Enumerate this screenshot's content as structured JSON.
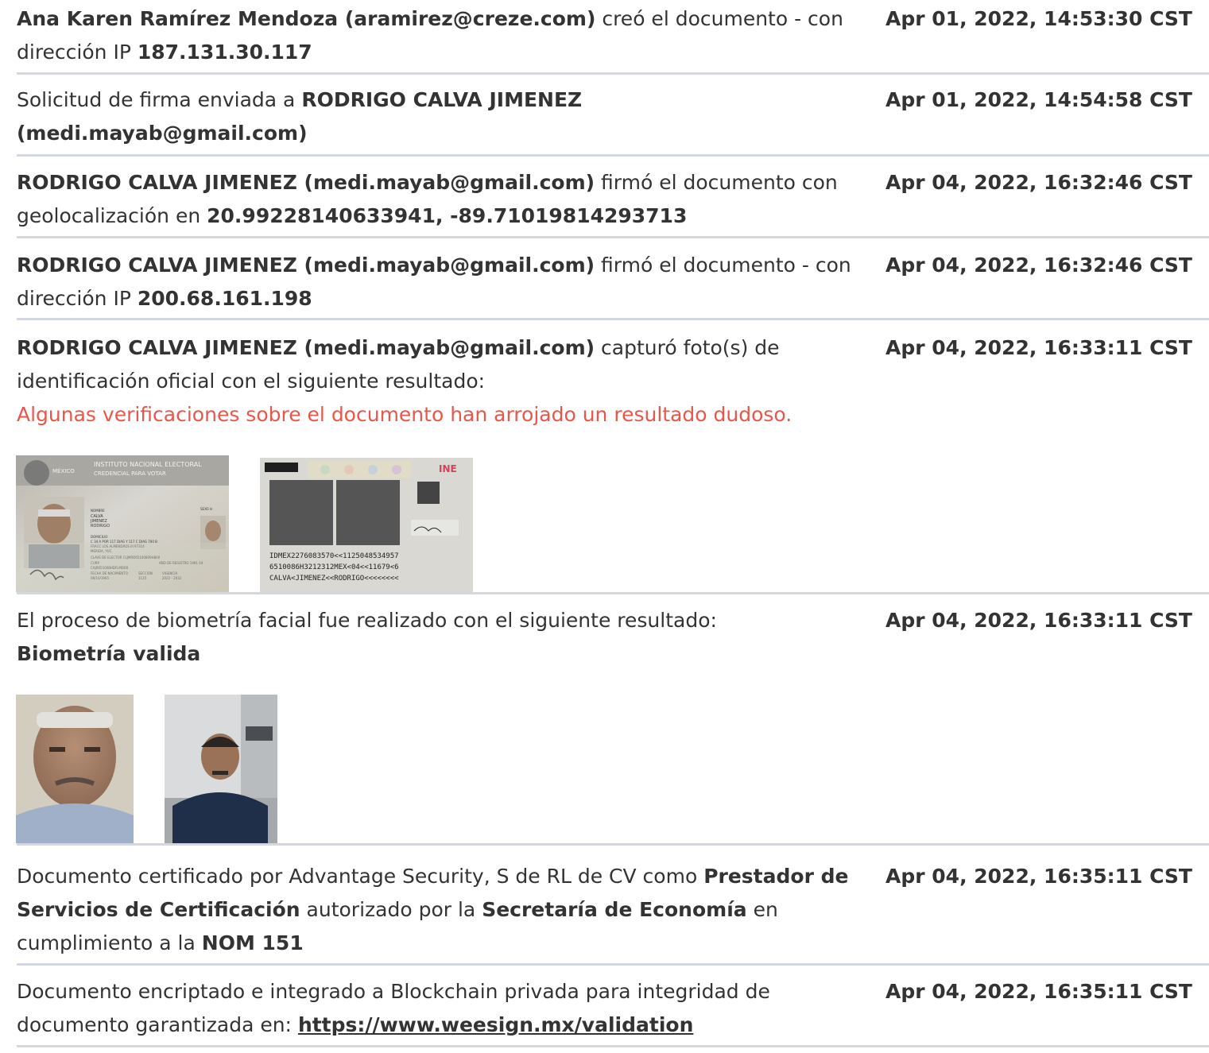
{
  "entries": [
    {
      "bold1": "Ana Karen Ramírez Mendoza (aramirez@creze.com)",
      "text1": " creó el documento - con dirección IP ",
      "bold2": "187.131.30.117",
      "timestamp": "Apr 01, 2022, 14:53:30 CST"
    },
    {
      "text1": "Solicitud de firma enviada a ",
      "bold1": "RODRIGO CALVA JIMENEZ (medi.mayab@gmail.com)",
      "timestamp": "Apr 01, 2022, 14:54:58 CST"
    },
    {
      "bold1": "RODRIGO CALVA JIMENEZ (medi.mayab@gmail.com)",
      "text1": " firmó el documento con geolocalización en ",
      "bold2": "20.99228140633941, -89.71019814293713",
      "timestamp": "Apr 04, 2022, 16:32:46 CST"
    },
    {
      "bold1": "RODRIGO CALVA JIMENEZ (medi.mayab@gmail.com)",
      "text1": " firmó el documento - con dirección IP ",
      "bold2": "200.68.161.198",
      "timestamp": "Apr 04, 2022, 16:32:46 CST"
    },
    {
      "bold1": "RODRIGO CALVA JIMENEZ (medi.mayab@gmail.com)",
      "text1": " capturó foto(s) de identificación oficial con el siguiente resultado:",
      "warning": "Algunas verificaciones sobre el documento han arrojado un resultado dudoso.",
      "timestamp": "Apr 04, 2022, 16:33:11 CST",
      "id_front": {
        "country": "MÉXICO",
        "institute": "INSTITUTO NACIONAL ELECTORAL",
        "card_type": "CREDENCIAL PARA VOTAR",
        "name_label": "NOMBRE",
        "name_lines": [
          "CALVA",
          "JIMENEZ",
          "RODRIGO"
        ],
        "sex": "SEXO H",
        "address_label": "DOMICILIO",
        "address_lines": [
          "C 34 A POR 117 DIAG Y 117 C DIAG 700 B",
          "FRACC LOS ALMENDROS III 97314",
          "MERIDA, YUC."
        ],
        "elector_key": "CLAVE DE ELECTOR  CLJMRD65100809H800",
        "curp_label": "CURP",
        "curp": "CAJR651008HDFLMD08",
        "registration": "AÑO DE REGISTRO 1991 04",
        "dob_label": "FECHA DE NACIMIENTO",
        "dob": "08/10/1965",
        "section_label": "SECCIÓN",
        "section": "1125",
        "validity_label": "VIGENCIA",
        "validity": "2022 - 2032"
      },
      "id_back": {
        "brand": "INE",
        "mrz": [
          "IDMEX2276083570<<1125048534957",
          "6510086H3212312MEX<04<<11679<6",
          "CALVA<JIMENEZ<<RODRIGO<<<<<<<<"
        ]
      }
    },
    {
      "text1": "El proceso de biometría facial fue realizado con el siguiente resultado:",
      "bold1": "Biometría valida",
      "timestamp": "Apr 04, 2022, 16:33:11 CST"
    },
    {
      "text1": "Documento certificado por Advantage Security, S de RL de CV como ",
      "bold1": "Prestador de Servicios de Certificación",
      "text2": " autorizado por la ",
      "bold2": "Secretaría de Economía",
      "text3": " en cumplimiento a la ",
      "bold3": "NOM 151",
      "timestamp": "Apr 04, 2022, 16:35:11 CST"
    },
    {
      "text1": "Documento encriptado e integrado a Blockchain privada para integridad de documento garantizada en: ",
      "link": "https://www.weesign.mx/validation",
      "timestamp": "Apr 04, 2022, 16:35:11 CST"
    }
  ],
  "colors": {
    "text": "#333333",
    "warning": "#e8574a",
    "divider": "#d3d7df"
  }
}
